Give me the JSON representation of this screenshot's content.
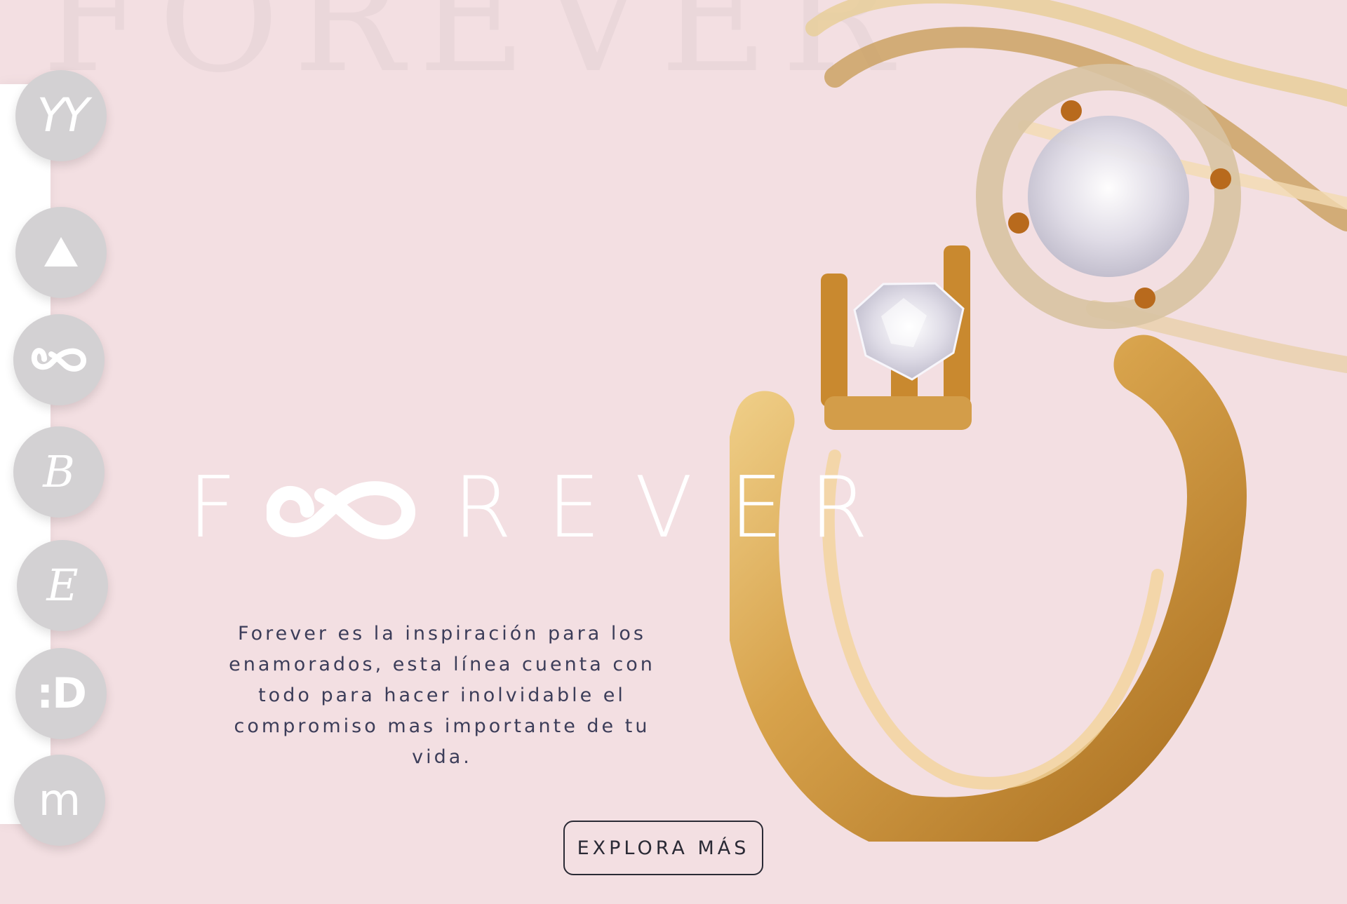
{
  "background_color": "#f3dfe2",
  "nav": {
    "items": [
      {
        "label": "YY",
        "icon": "yy-logo-icon"
      },
      {
        "label": "",
        "icon": "triangle-logo-icon"
      },
      {
        "label": "",
        "icon": "infinity-logo-icon"
      },
      {
        "label": "B",
        "icon": "b-logo-icon"
      },
      {
        "label": "E",
        "icon": "e-logo-icon"
      },
      {
        "label": ":D",
        "icon": "d-logo-icon"
      },
      {
        "label": "m",
        "icon": "m-logo-icon"
      }
    ],
    "button_color": "#d3d1d3"
  },
  "hero": {
    "logo_letters": [
      "F",
      "R",
      "E",
      "V",
      "E",
      "R"
    ],
    "tagline": "Forever es la inspiración para los enamorados, esta línea cuenta con todo para hacer inolvidable el compromiso mas importante de tu vida.",
    "cta_label": "EXPLORA MÁS",
    "text_color": "#3c3d59"
  },
  "colors": {
    "gold": "#d7a24b",
    "diamond": "#e9e7ef",
    "logo_white": "#ffffff"
  }
}
